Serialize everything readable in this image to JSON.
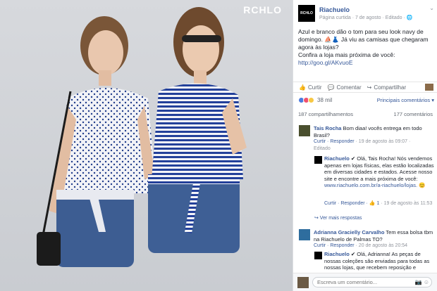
{
  "photo": {
    "brand": "RCHLO"
  },
  "post": {
    "page_name": "Riachuelo",
    "meta": "Página curtida · 7 de agosto · Editado · 🌐",
    "logo_text": "RCHLO",
    "text_lines": [
      "Azul e branco dão o tom para seu look navy de",
      "domingo. ⛵👗 Já viu as camisas que chegaram",
      "agora às lojas?",
      "Confira a loja mais próxima de você:"
    ],
    "link": "http://goo.gl/AKvuoE",
    "actions": {
      "like": "Curtir",
      "comment": "Comentar",
      "share": "Compartilhar"
    },
    "reactions_count": "38 mil",
    "relevant": "Principais comentários ▾",
    "shares": "187 compartilhamentos",
    "comments_count": "177 comentários"
  },
  "comments": [
    {
      "name": "Tais Rocha",
      "text": " Bom diaa! vocês entrega em todo Brasil?",
      "meta_prefix": "Curtir · Responder",
      "meta_time": " · 19 de agosto às 09:07 ·",
      "meta_extra": "Editado"
    },
    {
      "name": "Riachuelo",
      "text": " ✔ Olá, Tais Rocha! Nós vendemos apenas em lojas físicas, elas estão localizadas em diversas cidades e estados. Acesse nosso site e encontre a mais próxima de você:",
      "link": "www.riachuelo.com.br/a-riachuelo/lojas.",
      "emoji": "😊",
      "meta_prefix": "Curtir · Responder",
      "meta_likes": " · 👍 1",
      "meta_time": " · 19 de agosto às 11:53"
    },
    {
      "more_replies": "↪ Ver mais respostas"
    },
    {
      "name": "Adrianna Gracielly Carvalho",
      "text": " Tem essa bolsa tbm na Riachuelo de Palmas TO?",
      "meta_prefix": "Curtir · Responder",
      "meta_time": " · 20 de agosto às 20:54"
    },
    {
      "name": "Riachuelo",
      "text": " ✔ Olá, Adrianna! As peças de nossas coleções são enviadas para todas as nossas lojas, que recebem reposição e"
    }
  ],
  "composer": {
    "placeholder": "Escreva um comentário...",
    "icons": "📷 ☺"
  },
  "colors": {
    "link": "#365899",
    "muted": "#90949c",
    "navy": "#1f3b8a"
  }
}
